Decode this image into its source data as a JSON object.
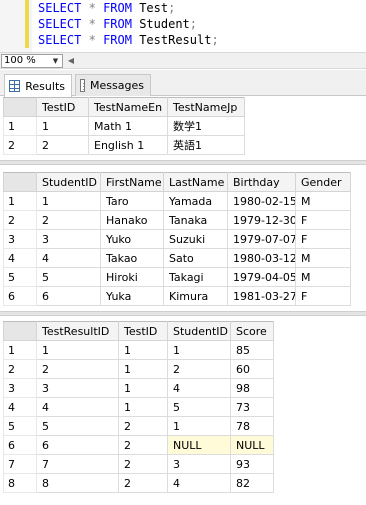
{
  "editor": {
    "lines": [
      {
        "kw1": "SELECT",
        "star": "*",
        "kw2": "FROM",
        "table": "Test",
        "semi": ";"
      },
      {
        "kw1": "SELECT",
        "star": "*",
        "kw2": "FROM",
        "table": "Student",
        "semi": ";"
      },
      {
        "kw1": "SELECT",
        "star": "*",
        "kw2": "FROM",
        "table": "TestResult",
        "semi": ";"
      }
    ]
  },
  "zoom": {
    "value": "100 %"
  },
  "tabs": {
    "results_label": "Results",
    "messages_label": "Messages"
  },
  "colors": {
    "keyword": "#0000ff",
    "null_cell": "#fffbd8",
    "change_bar": "#f0d84c"
  },
  "grid1": {
    "columns": [
      "TestID",
      "TestNameEn",
      "TestNameJp"
    ],
    "rows": [
      [
        "1",
        "1",
        "Math 1",
        "数学1"
      ],
      [
        "2",
        "2",
        "English 1",
        "英語1"
      ]
    ]
  },
  "grid2": {
    "columns": [
      "StudentID",
      "FirstName",
      "LastName",
      "Birthday",
      "Gender"
    ],
    "rows": [
      [
        "1",
        "1",
        "Taro",
        "Yamada",
        "1980-02-15",
        "M"
      ],
      [
        "2",
        "2",
        "Hanako",
        "Tanaka",
        "1979-12-30",
        "F"
      ],
      [
        "3",
        "3",
        "Yuko",
        "Suzuki",
        "1979-07-07",
        "F"
      ],
      [
        "4",
        "4",
        "Takao",
        "Sato",
        "1980-03-12",
        "M"
      ],
      [
        "5",
        "5",
        "Hiroki",
        "Takagi",
        "1979-04-05",
        "M"
      ],
      [
        "6",
        "6",
        "Yuka",
        "Kimura",
        "1981-03-27",
        "F"
      ]
    ]
  },
  "grid3": {
    "columns": [
      "TestResultID",
      "TestID",
      "StudentID",
      "Score"
    ],
    "rows": [
      [
        "1",
        "1",
        "1",
        "1",
        "85"
      ],
      [
        "2",
        "2",
        "1",
        "2",
        "60"
      ],
      [
        "3",
        "3",
        "1",
        "4",
        "98"
      ],
      [
        "4",
        "4",
        "1",
        "5",
        "73"
      ],
      [
        "5",
        "5",
        "2",
        "1",
        "78"
      ],
      [
        "6",
        "6",
        "2",
        "NULL",
        "NULL"
      ],
      [
        "7",
        "7",
        "2",
        "3",
        "93"
      ],
      [
        "8",
        "8",
        "2",
        "4",
        "82"
      ]
    ]
  }
}
